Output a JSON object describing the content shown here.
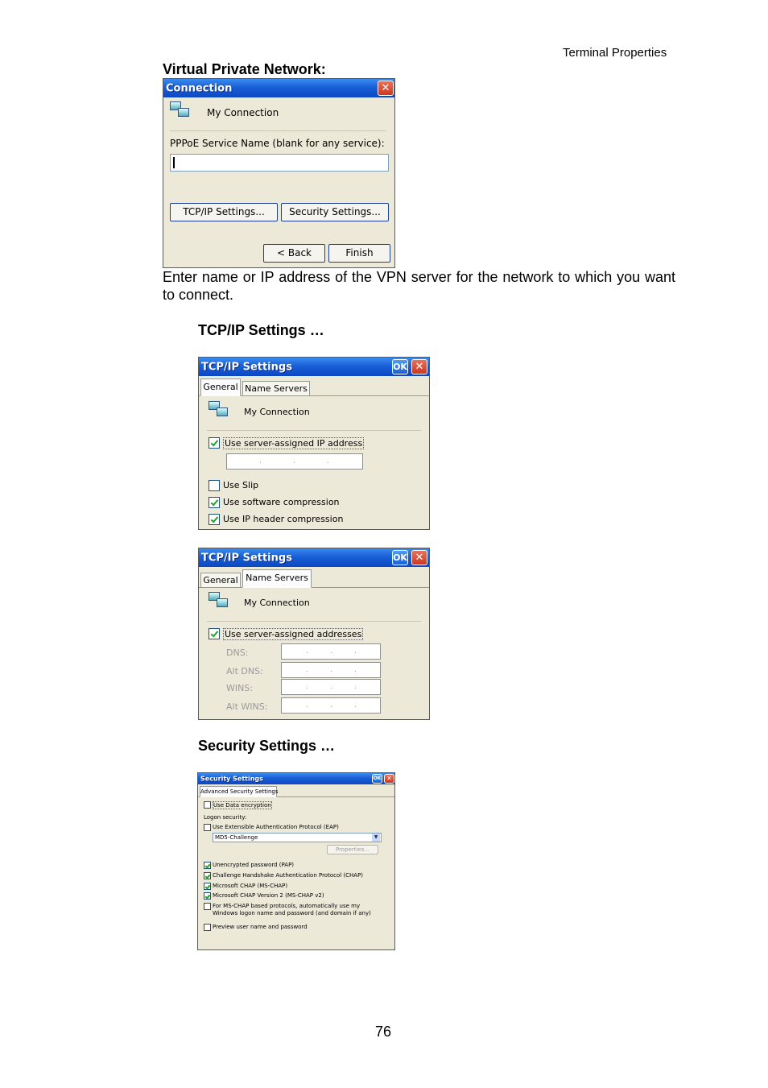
{
  "header": {
    "right": "Terminal Properties"
  },
  "sections": {
    "vpn_title": "Virtual Private Network:",
    "tcp_title": "TCP/IP Settings …",
    "security_title": "Security Settings …"
  },
  "description": "Enter name or IP address of the VPN server for the network to which you want to connect.",
  "page_number": "76",
  "connection_dialog": {
    "title": "Connection",
    "name": "My Connection",
    "pppoe_label": "PPPoE Service Name (blank for any service):",
    "pppoe_value": "",
    "tcp_button": "TCP/IP Settings...",
    "security_button": "Security Settings...",
    "back_button": "< Back",
    "finish_button": "Finish"
  },
  "tcp_dialog1": {
    "title": "TCP/IP Settings",
    "ok": "OK",
    "tabs": [
      "General",
      "Name Servers"
    ],
    "name": "My Connection",
    "server_ip": "Use server-assigned IP address",
    "use_slip": "Use Slip",
    "software_comp": "Use software compression",
    "ip_header_comp": "Use IP header compression",
    "checks": {
      "server_ip": true,
      "use_slip": false,
      "software_comp": true,
      "ip_header_comp": true
    }
  },
  "tcp_dialog2": {
    "title": "TCP/IP Settings",
    "ok": "OK",
    "tabs": [
      "General",
      "Name Servers"
    ],
    "name": "My Connection",
    "server_addr": "Use server-assigned addresses",
    "dns": "DNS:",
    "alt_dns": "Alt DNS:",
    "wins": "WINS:",
    "alt_wins": "Alt WINS:",
    "checks": {
      "server_addr": true
    }
  },
  "security_dialog": {
    "title": "Security Settings",
    "ok": "OK",
    "tab": "Advanced Security Settings",
    "data_enc": "Use Data encryption",
    "logon": "Logon security:",
    "eap": "Use Extensible Authentication Protocol (EAP)",
    "eap_value": "MD5-Challenge",
    "properties": "Properties...",
    "pap": "Unencrypted password (PAP)",
    "chap": "Challenge Handshake Authentication Protocol (CHAP)",
    "mschap": "Microsoft CHAP (MS-CHAP)",
    "mschap2": "Microsoft CHAP Version 2 (MS-CHAP v2)",
    "auto_line1": "For MS-CHAP based protocols, automatically use my",
    "auto_line2": "Windows logon name and password (and domain if any)",
    "preview": "Preview user name and password",
    "checks": {
      "data_enc": false,
      "eap": false,
      "pap": true,
      "chap": true,
      "mschap": true,
      "mschap2": true,
      "auto": false,
      "preview": false
    }
  },
  "colors": {
    "titlebar": "#1a5fd6",
    "dialog_bg": "#ece9d8",
    "check": "#22a12a"
  }
}
